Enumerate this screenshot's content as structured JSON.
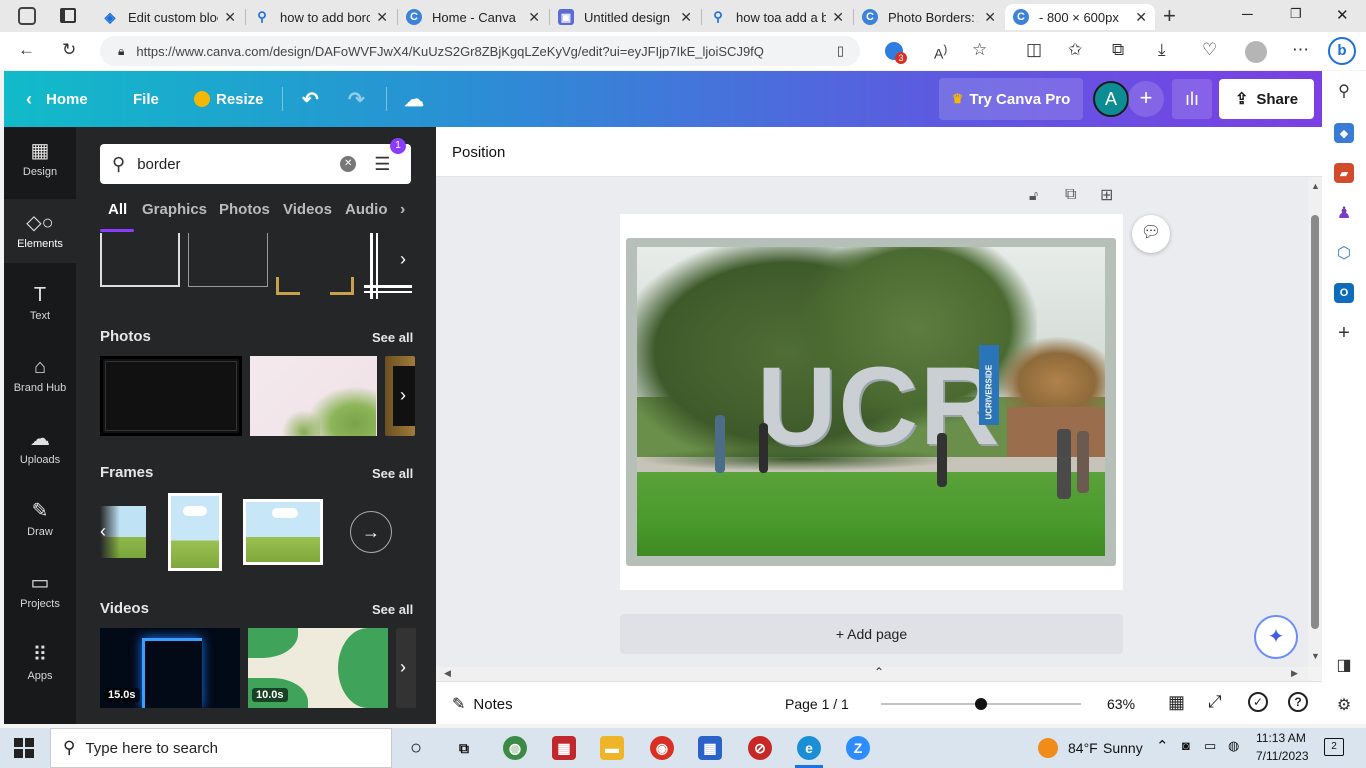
{
  "browser": {
    "tabs": [
      {
        "label": "Edit custom bloc",
        "icon": "edge-icon"
      },
      {
        "label": "how to add borc",
        "icon": "search-icon"
      },
      {
        "label": "Home - Canva",
        "icon": "canva-icon"
      },
      {
        "label": "Untitled design",
        "icon": "canva-design-icon"
      },
      {
        "label": "how toa add a b",
        "icon": "search-icon"
      },
      {
        "label": "Photo Borders: A",
        "icon": "canva-icon"
      },
      {
        "label": "- 800 × 600px",
        "icon": "canva-icon"
      }
    ],
    "new_tab": "+",
    "url": "https://www.canva.com/design/DAFoWVFJwX4/KuUzS2Gr8ZBjKgqLZeKyVg/edit?ui=eyJFIjp7IkE_ljoiSCJ9fQ",
    "extension_badge": "3"
  },
  "header": {
    "home": "Home",
    "file": "File",
    "resize": "Resize",
    "try_pro": "Try Canva Pro",
    "avatar_letter": "A",
    "share": "Share"
  },
  "rail": [
    {
      "label": "Design",
      "icon": "design-icon"
    },
    {
      "label": "Elements",
      "icon": "elements-icon"
    },
    {
      "label": "Text",
      "icon": "text-icon"
    },
    {
      "label": "Brand Hub",
      "icon": "brand-hub-icon"
    },
    {
      "label": "Uploads",
      "icon": "uploads-icon"
    },
    {
      "label": "Draw",
      "icon": "draw-icon"
    },
    {
      "label": "Projects",
      "icon": "projects-icon"
    },
    {
      "label": "Apps",
      "icon": "apps-icon"
    }
  ],
  "panel": {
    "search_value": "border",
    "filter_badge": "1",
    "tabs": [
      "All",
      "Graphics",
      "Photos",
      "Videos",
      "Audio"
    ],
    "sections": {
      "photos": "Photos",
      "frames": "Frames",
      "videos": "Videos",
      "see_all": "See all"
    },
    "video_durations": [
      "15.0s",
      "10.0s"
    ]
  },
  "editor": {
    "position_label": "Position",
    "add_page": "+ Add page",
    "notes": "Notes",
    "page_indicator": "Page 1 / 1",
    "zoom": "63%",
    "zoom_level": 0.5,
    "photo_sign": "UCR",
    "banner_text": "UCRIVERSIDE"
  },
  "taskbar": {
    "search_placeholder": "Type here to search",
    "weather_temp": "84°F",
    "weather_desc": "Sunny",
    "time": "11:13 AM",
    "date": "7/11/2023",
    "notif_count": "2"
  },
  "colors": {
    "accent_purple": "#8b3dff",
    "header_start": "#11bbc9",
    "header_end": "#7b3fe4",
    "panel_bg": "#252627",
    "rail_bg": "#18191b"
  }
}
